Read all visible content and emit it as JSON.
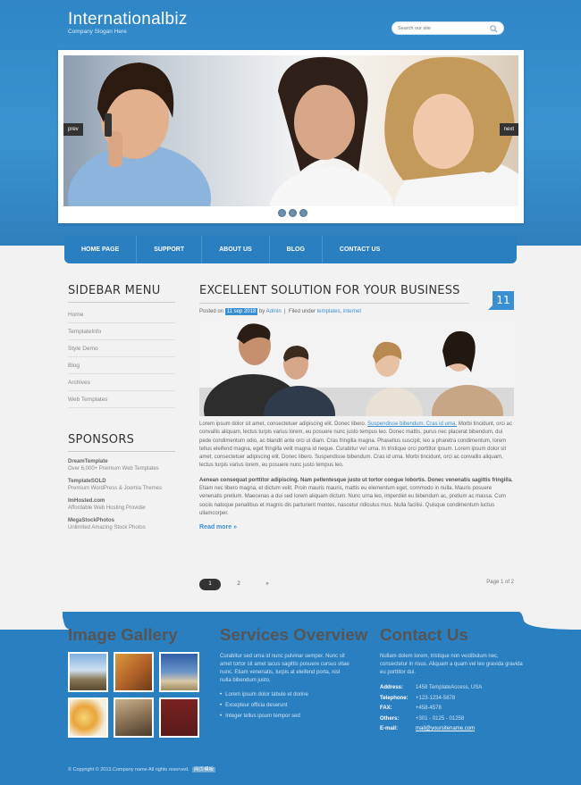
{
  "header": {
    "logo": "Internationalbiz",
    "slogan": "Company Slogan Here",
    "search_placeholder": "Search our site"
  },
  "slider": {
    "prev_label": "prev",
    "next_label": "next",
    "dot_count": 3
  },
  "nav": {
    "items": [
      "HOME PAGE",
      "SUPPORT",
      "ABOUT US",
      "BLOG",
      "CONTACT US"
    ]
  },
  "sidebar": {
    "menu_heading": "SIDEBAR MENU",
    "menu_items": [
      "Home",
      "TemplateInfo",
      "Style Demo",
      "Blog",
      "Archives",
      "Web Templates"
    ],
    "sponsors_heading": "SPONSORS",
    "sponsors": [
      {
        "name": "DreamTemplate",
        "desc": "Over 6,000+ Premium Web Templates"
      },
      {
        "name": "TemplateSOLD",
        "desc": "Premium WordPress & Joomla Themes"
      },
      {
        "name": "ImHosted.com",
        "desc": "Affordable Web Hosting Provider"
      },
      {
        "name": "MegaStockPhotos",
        "desc": "Unlimited Amazing Stock Photos"
      }
    ]
  },
  "post": {
    "title": "EXCELLENT SOLUTION FOR YOUR BUSINESS",
    "date_badge": "11",
    "meta_posted": "Posted on",
    "meta_date": "11 sep 2018",
    "meta_by": "by",
    "meta_author": "Admin",
    "meta_filed": "Filed under",
    "meta_cat1": "templates",
    "meta_cat2": "internet",
    "para1_a": "Lorem ipsum dolor sit amet, consectetuer adipiscing elit. Donec libero. ",
    "para1_link": "Suspendisse bibendum. Cras id urna.",
    "para1_b": " Morbi tincidunt, orci ac convallis aliquam, lectus turpis varius lorem, eu posuere nunc justo tempus leo. Donec mattis, purus nec placerat bibendum, dui pede condimentum odio, ac blandit ante orci ut diam. Cras fringilla magna. Phasellus suscipit, leo a pharetra condimentum, lorem tellus eleifend magna, eget fringilla velit magna id neque. Curabitur vel urna. In tristique orci porttitor ipsum. Lorem ipsum dolor sit amet, consectetuer adipiscing elit. Donec libero. Suspendisse bibendum. Cras id urna. Morbi tincidunt, orci ac convallis aliquam, lectus turpis varius lorem, eu posuere nunc justo tempus leo.",
    "para2_bold": "Aenean consequat porttitor adipiscing. Nam pellentesque justo ut tortor congue lobortis. Donec venenatis sagittis fringilla.",
    "para2_rest": " Etiam nec libero magna, et dictum velit. Proin mauris mauris, mattis eu elementum eget, commodo in nulla. Mauris posuere venenatis pretium. Maecenas a dui sed lorem aliquam dictum. Nunc urna leo, imperdiet eu bibendum ac, pretium ac massa. Cum sociis natoque penatibus et magnis dis parturient montes, nascetur ridiculus mus. Nulla facilisi. Quisque condimentum luctus ullamcorper.",
    "read_more": "Read more »",
    "pages": [
      "1",
      "2",
      "»"
    ],
    "page_of": "Page 1 of 2"
  },
  "footer": {
    "gallery_heading": "Image Gallery",
    "services_heading": "Services Overview",
    "contact_heading": "Contact Us",
    "services_text": "Curabitur sed urna id nunc pulvinar semper. Nunc sit amet tortor sit amet lacus sagittis posuere cursus vitae nunc. Etiam venenatis, turpis at eleifend porta, nisl nulla bibendum justo.",
    "services_list": [
      "Lorem ipsum dolor tabule et dorine",
      "Excepteur officia deserunt",
      "Integer tellus ipsum tempor sed"
    ],
    "contact_text": "Nullam dolem lorem, tristique non vestibulum nec, consectetur in risus. Aliquam a quam vel leo gravida gravida eu porttitor dui.",
    "contact_rows": [
      {
        "label": "Address:",
        "value": "1458 TemplateAccess, USA"
      },
      {
        "label": "Telephone:",
        "value": "+123-1234-5678"
      },
      {
        "label": "FAX:",
        "value": "+458-4578"
      },
      {
        "label": "Others:",
        "value": "+301 - 0125 - 01258"
      },
      {
        "label": "E-mail:",
        "value": "mail@yoursitename.com"
      }
    ],
    "copyright": "© Copyright © 2013.Company name All rights reserved.",
    "copyright_badge": "网页模板"
  },
  "colors": {
    "brand_blue": "#2a7fc1",
    "accent_blue": "#3a8fd2",
    "light_bg": "#f2f2f2"
  }
}
